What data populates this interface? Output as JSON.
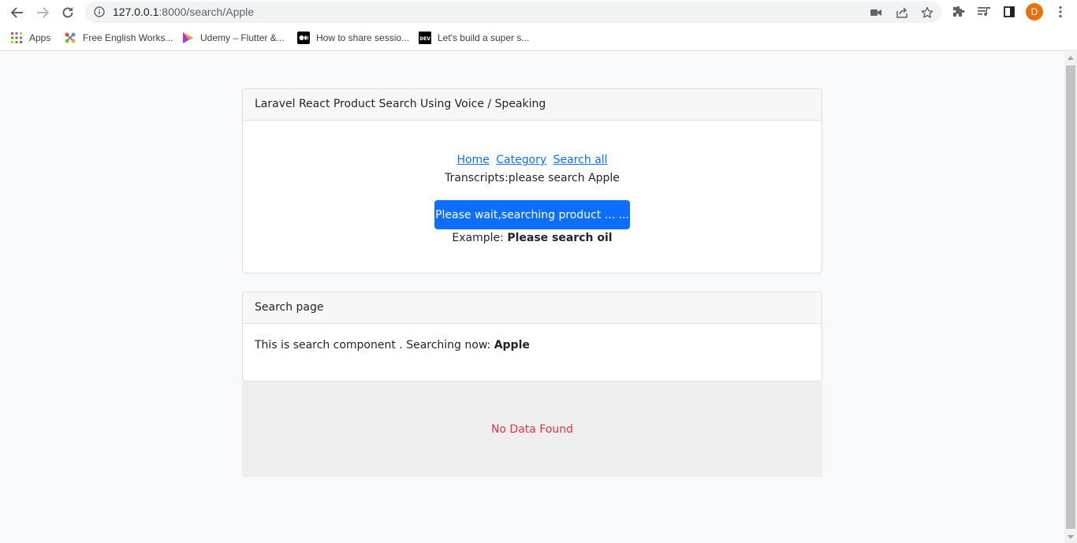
{
  "browser": {
    "url_host": "127.0.0.1",
    "url_rest": ":8000/search/Apple",
    "avatar_letter": "D",
    "bookmarks": [
      {
        "label": "Apps",
        "icon": "apps-grid-icon"
      },
      {
        "label": "Free English Works...",
        "icon": "joomla-icon"
      },
      {
        "label": "Udemy – Flutter &...",
        "icon": "udemy-play-icon"
      },
      {
        "label": "How to share sessio...",
        "icon": "medium-icon"
      },
      {
        "label": "Let's build a super s...",
        "icon": "dev-icon"
      }
    ]
  },
  "card1": {
    "header": "Laravel React Product Search Using Voice / Speaking",
    "links": [
      "Home",
      "Category",
      "Search all"
    ],
    "transcript": "Transcripts:please search Apple",
    "button": "Please wait,searching product ... ...",
    "example_prefix": "Example: ",
    "example_text": "Please search oil"
  },
  "card2": {
    "header": "Search page",
    "body_prefix": "This is search component . Searching now: ",
    "query": "Apple"
  },
  "no_data": "No Data Found",
  "colors": {
    "primary": "#0d6efd",
    "danger": "#dc3545",
    "avatar": "#e8710a"
  }
}
